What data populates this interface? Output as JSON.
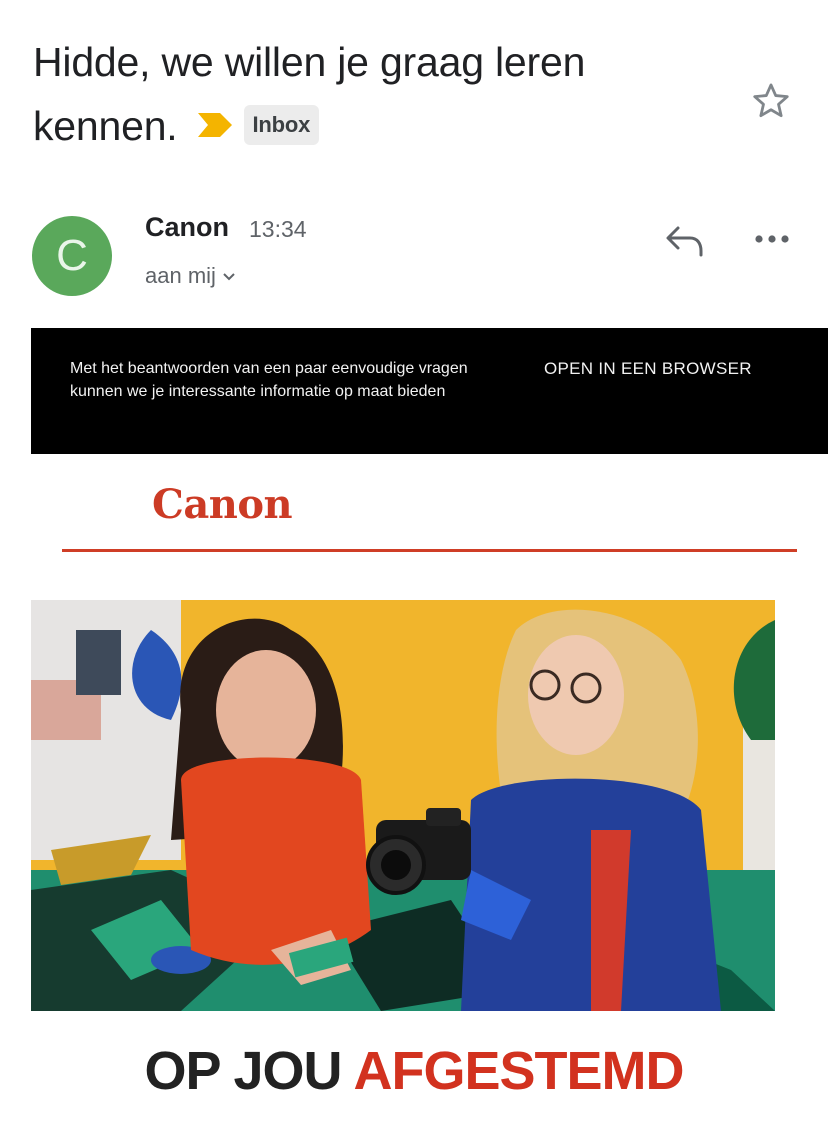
{
  "email": {
    "subject_line1": "Hidde, we willen je graag leren",
    "subject_line2": "kennen.",
    "label": "Inbox",
    "sender": {
      "name": "Canon",
      "initial": "C",
      "time": "13:34",
      "recipient": "aan mij"
    }
  },
  "body": {
    "preheader": "Met het beantwoorden van een paar eenvoudige vragen kunnen we je interessante informatie op maat bieden",
    "open_in_browser": "OPEN IN EEN BROWSER",
    "brand_logo": "Canon",
    "headline_part1": "OP JOU",
    "headline_part2": "AFGESTEMD"
  },
  "icons": [
    "important-marker-icon",
    "star-icon",
    "reply-icon",
    "more-options-icon",
    "chevron-down-icon"
  ],
  "colors": {
    "avatar": "#5aa85b",
    "important_marker": "#f4b400",
    "brand_red": "#cc3b25",
    "banner_bg": "#000000"
  }
}
